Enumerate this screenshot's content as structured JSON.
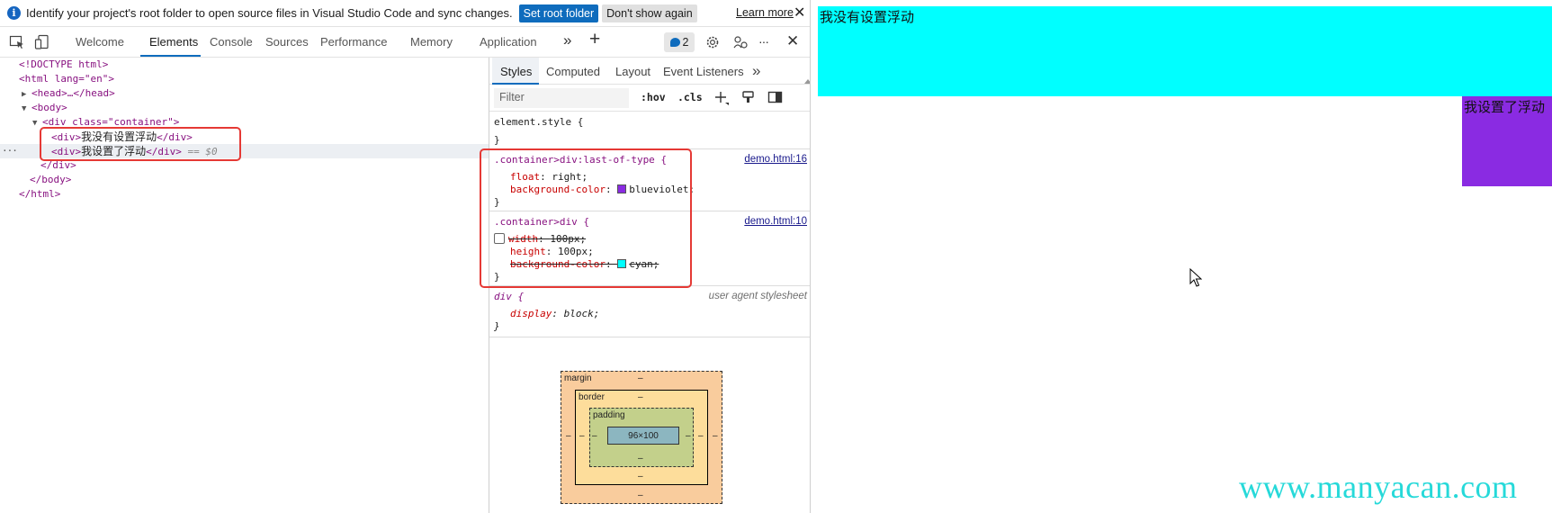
{
  "infobar": {
    "message": "Identify your project's root folder to open source files in Visual Studio Code and sync changes.",
    "set_root_button": "Set root folder",
    "dont_show_button": "Don't show again",
    "learn_more_link": "Learn more",
    "close_glyph": "✕"
  },
  "toolbar": {
    "tabs": [
      "Welcome",
      "Elements",
      "Console",
      "Sources",
      "Performance",
      "Memory",
      "Application"
    ],
    "active_tab": "Elements",
    "more_glyph": "»",
    "add_glyph": "+",
    "issues_count": "2",
    "overflow_glyph": "···",
    "close_glyph": "✕"
  },
  "dom_tree": {
    "doctype": "<!DOCTYPE html>",
    "html_open": "<html lang=\"en\">",
    "head": "<head>…</head>",
    "body_open": "<body>",
    "container_open": "<div class=\"container\">",
    "div1_open": "<div>",
    "div1_text": "我没有设置浮动",
    "div_close": "</div>",
    "div2_text": "我设置了浮动",
    "selected_marker": "== $0",
    "row_dots": "···",
    "container_close": "</div>",
    "body_close": "</body>",
    "html_close": "</html>"
  },
  "styles_panel": {
    "tabs": [
      "Styles",
      "Computed",
      "Layout",
      "Event Listeners"
    ],
    "active_tab": "Styles",
    "more_glyph": "»",
    "filter_placeholder": "Filter",
    "hov": ":hov",
    "cls": ".cls",
    "element_style": {
      "selector": "element.style {",
      "close": "}"
    },
    "rule1": {
      "selector": ".container>div:last-of-type {",
      "source": "demo.html:16",
      "decl1_prop": "float",
      "decl1_value": "right;",
      "decl2_prop": "background-color",
      "decl2_value": "blueviolet;",
      "decl2_color": "#8a2be2",
      "close": "}"
    },
    "rule2": {
      "selector": ".container>div {",
      "source": "demo.html:10",
      "decl1_prop": "width",
      "decl1_value": "100px;",
      "decl2_prop": "height",
      "decl2_value": "100px;",
      "decl3_prop": "background-color",
      "decl3_value": "cyan;",
      "decl3_color": "#00ffff",
      "close": "}"
    },
    "ua_rule": {
      "selector": "div {",
      "source": "user agent stylesheet",
      "decl_prop": "display",
      "decl_value": "block;",
      "close": "}"
    },
    "box_model": {
      "margin_label": "margin",
      "border_label": "border",
      "padding_label": "padding",
      "content_size": "96×100",
      "dash": "–"
    }
  },
  "page_preview": {
    "unfloated_text": "我没有设置浮动",
    "floated_text": "我设置了浮动",
    "watermark": "www.manyacan.com",
    "cyan_color": "#00ffff",
    "violet_color": "#8a2be2"
  }
}
